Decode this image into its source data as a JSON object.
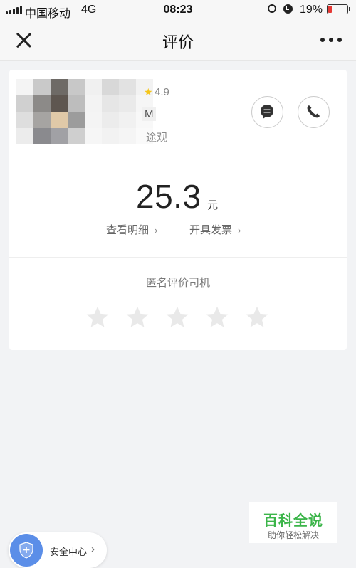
{
  "status_bar": {
    "carrier": "中国移动",
    "network": "4G",
    "time": "08:23",
    "battery_percent": "19%",
    "battery_level": 0.19,
    "battery_color": "#e53935"
  },
  "nav": {
    "title": "评价",
    "close_icon": "close-icon",
    "more_icon": "more-icon"
  },
  "driver": {
    "rating": "4.9",
    "rating_icon": "star-icon",
    "plate_partial": "M",
    "car_partial": "途观",
    "message_icon": "chat-bubble-icon",
    "call_icon": "phone-icon"
  },
  "fare": {
    "amount": "25.3",
    "unit": "元",
    "detail_label": "查看明细",
    "invoice_label": "开具发票",
    "chevron": "›"
  },
  "rating_section": {
    "title": "匿名评价司机",
    "stars_total": 5,
    "stars_selected": 0
  },
  "watermark": {
    "title": "百科全说",
    "subtitle": "助你轻松解决"
  },
  "safety_center": {
    "label": "安全中心",
    "chevron": "›",
    "icon": "shield-icon",
    "accent": "#5b8ee8"
  }
}
